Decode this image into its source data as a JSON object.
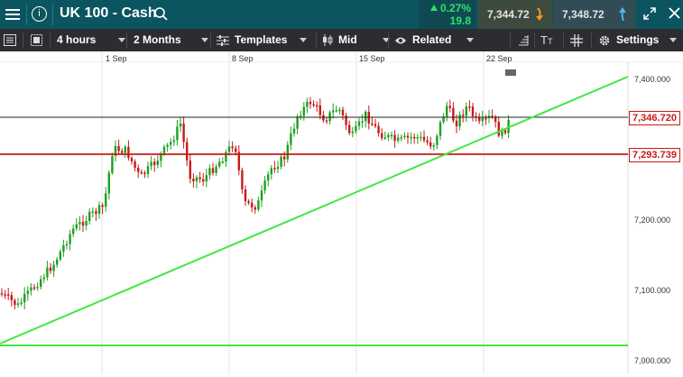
{
  "header": {
    "title": "UK 100 - Cash",
    "change_pct": "0.27%",
    "change_points": "19.8",
    "sell_price": "7,344.72",
    "buy_price": "7,348.72"
  },
  "toolbar": {
    "interval": "4 hours",
    "range": "2 Months",
    "templates": "Templates",
    "price_type": "Mid",
    "related": "Related",
    "settings": "Settings"
  },
  "chart": {
    "date_labels": [
      "1 Sep",
      "8 Sep",
      "15 Sep",
      "22 Sep"
    ],
    "price_labels": [
      "7,400.000",
      "7,200.000",
      "7,100.000",
      "7,000.000"
    ],
    "current_price_label": "7,346.720",
    "line_price_label": "7,293.739",
    "colors": {
      "up": "#1fa01f",
      "down": "#c71a1a",
      "trendline": "#3fe83f",
      "current_line": "#222222",
      "horizontal_level": "#c71a1a"
    }
  }
}
